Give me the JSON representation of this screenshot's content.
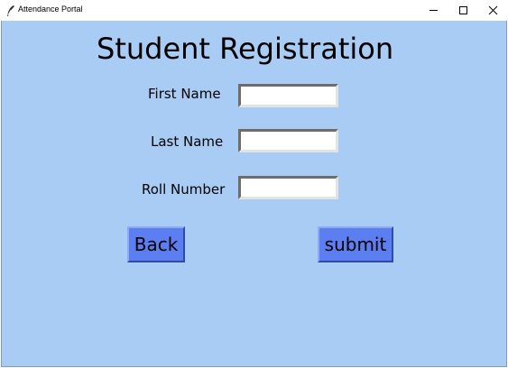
{
  "window": {
    "title": "Attendance Portal",
    "controls": {
      "minimize_icon": "minimize-icon",
      "maximize_icon": "maximize-icon",
      "close_icon": "close-icon"
    }
  },
  "form": {
    "heading": "Student Registration",
    "fields": [
      {
        "label": "First Name",
        "value": ""
      },
      {
        "label": "Last Name",
        "value": ""
      },
      {
        "label": "Roll Number",
        "value": ""
      }
    ],
    "buttons": {
      "back_label": "Back",
      "submit_label": "submit"
    }
  },
  "colors": {
    "background": "#a9ccf5",
    "button": "#5b7ff0",
    "field": "#ffffff"
  }
}
